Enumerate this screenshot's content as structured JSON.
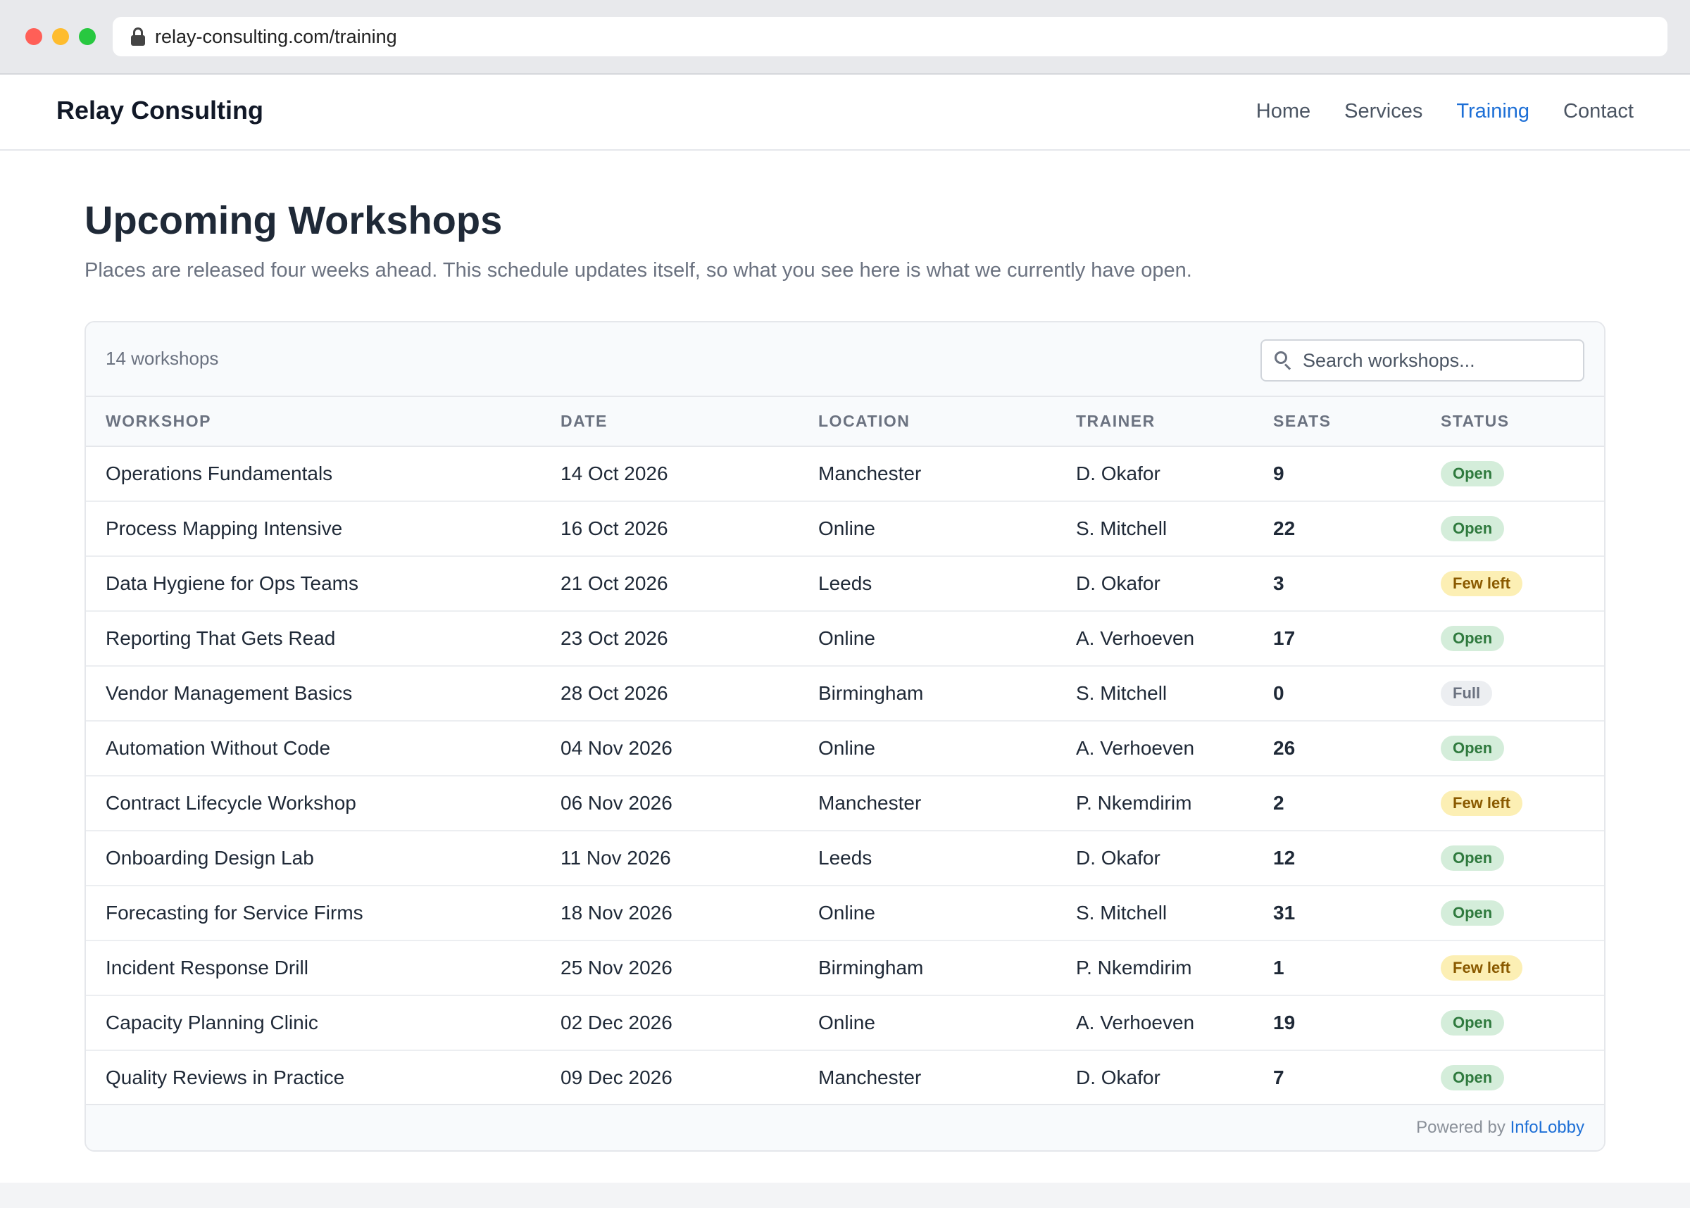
{
  "browser": {
    "url": "relay-consulting.com/training"
  },
  "header": {
    "brand": "Relay Consulting",
    "nav": [
      "Home",
      "Services",
      "Training",
      "Contact"
    ],
    "active_nav": "Training"
  },
  "main": {
    "title": "Upcoming Workshops",
    "subtitle": "Places are released four weeks ahead. This schedule updates itself, so what you see here is what we currently have open.",
    "count_label": "14 workshops",
    "search_placeholder": "Search workshops...",
    "columns": [
      "WORKSHOP",
      "DATE",
      "LOCATION",
      "TRAINER",
      "SEATS",
      "STATUS"
    ],
    "rows": [
      {
        "workshop": "Operations Fundamentals",
        "date": "14 Oct 2026",
        "location": "Manchester",
        "trainer": "D. Okafor",
        "seats": "9",
        "status": "Open"
      },
      {
        "workshop": "Process Mapping Intensive",
        "date": "16 Oct 2026",
        "location": "Online",
        "trainer": "S. Mitchell",
        "seats": "22",
        "status": "Open"
      },
      {
        "workshop": "Data Hygiene for Ops Teams",
        "date": "21 Oct 2026",
        "location": "Leeds",
        "trainer": "D. Okafor",
        "seats": "3",
        "status": "Few left"
      },
      {
        "workshop": "Reporting That Gets Read",
        "date": "23 Oct 2026",
        "location": "Online",
        "trainer": "A. Verhoeven",
        "seats": "17",
        "status": "Open"
      },
      {
        "workshop": "Vendor Management Basics",
        "date": "28 Oct 2026",
        "location": "Birmingham",
        "trainer": "S. Mitchell",
        "seats": "0",
        "status": "Full"
      },
      {
        "workshop": "Automation Without Code",
        "date": "04 Nov 2026",
        "location": "Online",
        "trainer": "A. Verhoeven",
        "seats": "26",
        "status": "Open"
      },
      {
        "workshop": "Contract Lifecycle Workshop",
        "date": "06 Nov 2026",
        "location": "Manchester",
        "trainer": "P. Nkemdirim",
        "seats": "2",
        "status": "Few left"
      },
      {
        "workshop": "Onboarding Design Lab",
        "date": "11 Nov 2026",
        "location": "Leeds",
        "trainer": "D. Okafor",
        "seats": "12",
        "status": "Open"
      },
      {
        "workshop": "Forecasting for Service Firms",
        "date": "18 Nov 2026",
        "location": "Online",
        "trainer": "S. Mitchell",
        "seats": "31",
        "status": "Open"
      },
      {
        "workshop": "Incident Response Drill",
        "date": "25 Nov 2026",
        "location": "Birmingham",
        "trainer": "P. Nkemdirim",
        "seats": "1",
        "status": "Few left"
      },
      {
        "workshop": "Capacity Planning Clinic",
        "date": "02 Dec 2026",
        "location": "Online",
        "trainer": "A. Verhoeven",
        "seats": "19",
        "status": "Open"
      },
      {
        "workshop": "Quality Reviews in Practice",
        "date": "09 Dec 2026",
        "location": "Manchester",
        "trainer": "D. Okafor",
        "seats": "7",
        "status": "Open"
      }
    ]
  },
  "footer": {
    "powered_prefix": "Powered by",
    "powered_brand": "InfoLobby"
  },
  "colors": {
    "accent": "#1d6fd6",
    "open_bg": "#d4edda",
    "few_bg": "#fcefb4",
    "full_bg": "#eceef1"
  },
  "icons": {
    "lock": "lock-icon",
    "search": "search-icon"
  }
}
